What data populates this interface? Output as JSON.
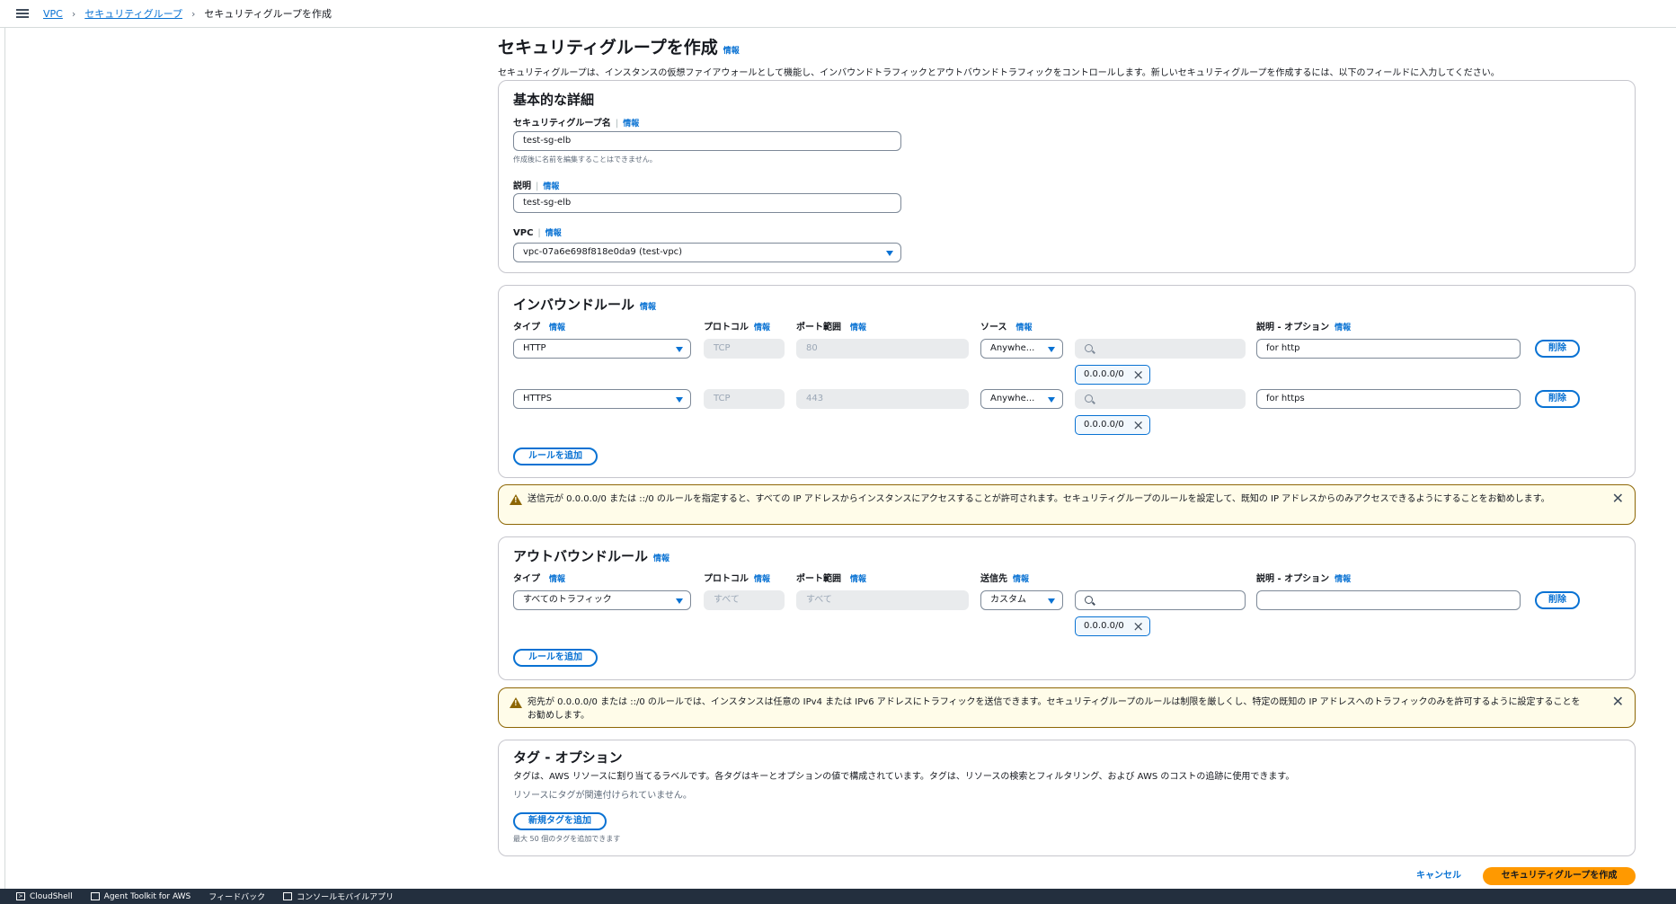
{
  "breadcrumb": {
    "items": [
      "VPC",
      "セキュリティグループ"
    ],
    "current": "セキュリティグループを作成"
  },
  "header": {
    "title": "セキュリティグループを作成",
    "info": "情報",
    "description": "セキュリティグループは、インスタンスの仮想ファイアウォールとして機能し、インバウンドトラフィックとアウトバウンドトラフィックをコントロールします。新しいセキュリティグループを作成するには、以下のフィールドに入力してください。"
  },
  "basic": {
    "title": "基本的な詳細",
    "name_label": "セキュリティグループ名",
    "name_value": "test-sg-elb",
    "name_hint": "作成後に名前を編集することはできません。",
    "desc_label": "説明",
    "desc_value": "test-sg-elb",
    "vpc_label": "VPC",
    "vpc_value": "vpc-07a6e698f818e0da9 (test-vpc)"
  },
  "common": {
    "info": "情報",
    "delete": "削除",
    "add_rule": "ルールを追加"
  },
  "inbound": {
    "title": "インバウンドルール",
    "col_type": "タイプ",
    "col_protocol": "プロトコル",
    "col_port": "ポート範囲",
    "col_source": "ソース",
    "col_desc": "説明 - オプション",
    "rules": [
      {
        "type": "HTTP",
        "protocol": "TCP",
        "port": "80",
        "source": "Anywhe...",
        "cidr": "0.0.0.0/0",
        "description": "for http"
      },
      {
        "type": "HTTPS",
        "protocol": "TCP",
        "port": "443",
        "source": "Anywhe...",
        "cidr": "0.0.0.0/0",
        "description": "for https"
      }
    ]
  },
  "inbound_alert": {
    "message": "送信元が 0.0.0.0/0 または ::/0 のルールを指定すると、すべての IP アドレスからインスタンスにアクセスすることが許可されます。セキュリティグループのルールを設定して、既知の IP アドレスからのみアクセスできるようにすることをお勧めします。"
  },
  "outbound": {
    "title": "アウトバウンドルール",
    "col_type": "タイプ",
    "col_protocol": "プロトコル",
    "col_port": "ポート範囲",
    "col_dest": "送信先",
    "col_desc": "説明 - オプション",
    "rules": [
      {
        "type": "すべてのトラフィック",
        "protocol": "すべて",
        "port": "すべて",
        "dest": "カスタム",
        "cidr": "0.0.0.0/0",
        "description": ""
      }
    ]
  },
  "outbound_alert": {
    "message": "宛先が 0.0.0.0/0 または ::/0 のルールでは、インスタンスは任意の IPv4 または IPv6 アドレスにトラフィックを送信できます。セキュリティグループのルールは制限を厳しくし、特定の既知の IP アドレスへのトラフィックのみを許可するように設定することをお勧めします。"
  },
  "tags": {
    "title": "タグ - オプション",
    "description": "タグは、AWS リソースに割り当てるラベルです。各タグはキーとオプションの値で構成されています。タグは、リソースの検索とフィルタリング、および AWS のコストの追跡に使用できます。",
    "empty": "リソースにタグが関連付けられていません。",
    "add_button": "新規タグを追加",
    "limit_hint": "最大 50 個のタグを追加できます"
  },
  "actions": {
    "cancel": "キャンセル",
    "create": "セキュリティグループを作成"
  },
  "bottombar": {
    "items": [
      "CloudShell",
      "Agent Toolkit for AWS",
      "フィードバック",
      "コンソールモバイルアプリ"
    ]
  },
  "colors": {
    "link": "#0972d3",
    "primary": "#ff9900",
    "warning_bg": "#fffce9",
    "warning_border": "#8d6605",
    "bottombar": "#232f3e"
  }
}
